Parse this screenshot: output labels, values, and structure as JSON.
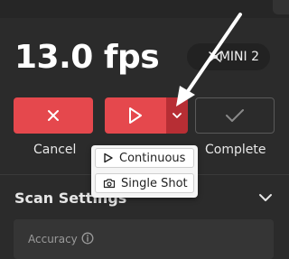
{
  "status": {
    "fps": "13.0 fps"
  },
  "device": {
    "name": "MINI 2",
    "icon": "drone-icon"
  },
  "controls": {
    "cancel_label": "Cancel",
    "complete_label": "Complete",
    "start_icon": "play-icon",
    "mode_icon": "chevron-down-icon"
  },
  "mode_menu": {
    "items": [
      {
        "label": "Continuous",
        "icon": "play-icon"
      },
      {
        "label": "Single Shot",
        "icon": "camera-icon"
      }
    ]
  },
  "scan_settings": {
    "title": "Scan Settings",
    "accuracy_label": "Accuracy"
  },
  "colors": {
    "accent": "#e5484d",
    "accent_dark": "#b72e34",
    "background": "#2b2b2b"
  }
}
